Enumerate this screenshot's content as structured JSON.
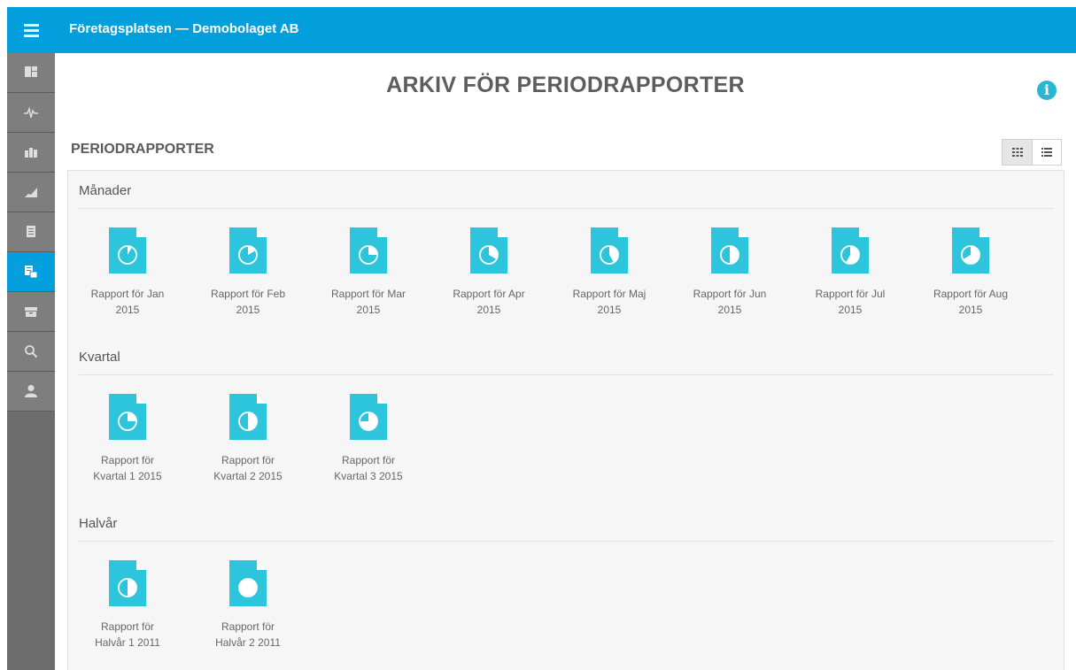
{
  "app": {
    "title": "Företagsplatsen — Demobolaget AB"
  },
  "page": {
    "title": "ARKIV FÖR PERIODRAPPORTER",
    "section_title": "PERIODRAPPORTER"
  },
  "groups": [
    {
      "title": "Månader",
      "reports": [
        {
          "line1": "Rapport för Jan",
          "line2": "2015",
          "pie": "1/12"
        },
        {
          "line1": "Rapport för Feb",
          "line2": "2015",
          "pie": "2/12"
        },
        {
          "line1": "Rapport för Mar",
          "line2": "2015",
          "pie": "3/12"
        },
        {
          "line1": "Rapport för Apr",
          "line2": "2015",
          "pie": "4/12"
        },
        {
          "line1": "Rapport för Maj",
          "line2": "2015",
          "pie": "5/12"
        },
        {
          "line1": "Rapport för Jun",
          "line2": "2015",
          "pie": "6/12"
        },
        {
          "line1": "Rapport för Jul",
          "line2": "2015",
          "pie": "7/12"
        },
        {
          "line1": "Rapport för Aug",
          "line2": "2015",
          "pie": "8/12"
        }
      ]
    },
    {
      "title": "Kvartal",
      "reports": [
        {
          "line1": "Rapport för",
          "line2": "Kvartal 1 2015",
          "pie": "1/4"
        },
        {
          "line1": "Rapport för",
          "line2": "Kvartal 2 2015",
          "pie": "2/4"
        },
        {
          "line1": "Rapport för",
          "line2": "Kvartal 3 2015",
          "pie": "3/4"
        }
      ]
    },
    {
      "title": "Halvår",
      "reports": [
        {
          "line1": "Rapport för",
          "line2": "Halvår 1 2011",
          "pie": "1/2"
        },
        {
          "line1": "Rapport för",
          "line2": "Halvår 2 2011",
          "pie": "2/2"
        }
      ]
    }
  ],
  "sidebar": {
    "items": [
      "dashboard-icon",
      "pulse-icon",
      "buildings-icon",
      "area-chart-icon",
      "document-icon",
      "reports-icon",
      "archive-icon",
      "search-icon",
      "user-icon"
    ],
    "active_index": 5
  },
  "view": {
    "active": "grid"
  },
  "colors": {
    "topbar": "#039fdd",
    "sidebar": "#7e7e7e",
    "active": "#049fdd",
    "doc": "#2cc5dc"
  }
}
